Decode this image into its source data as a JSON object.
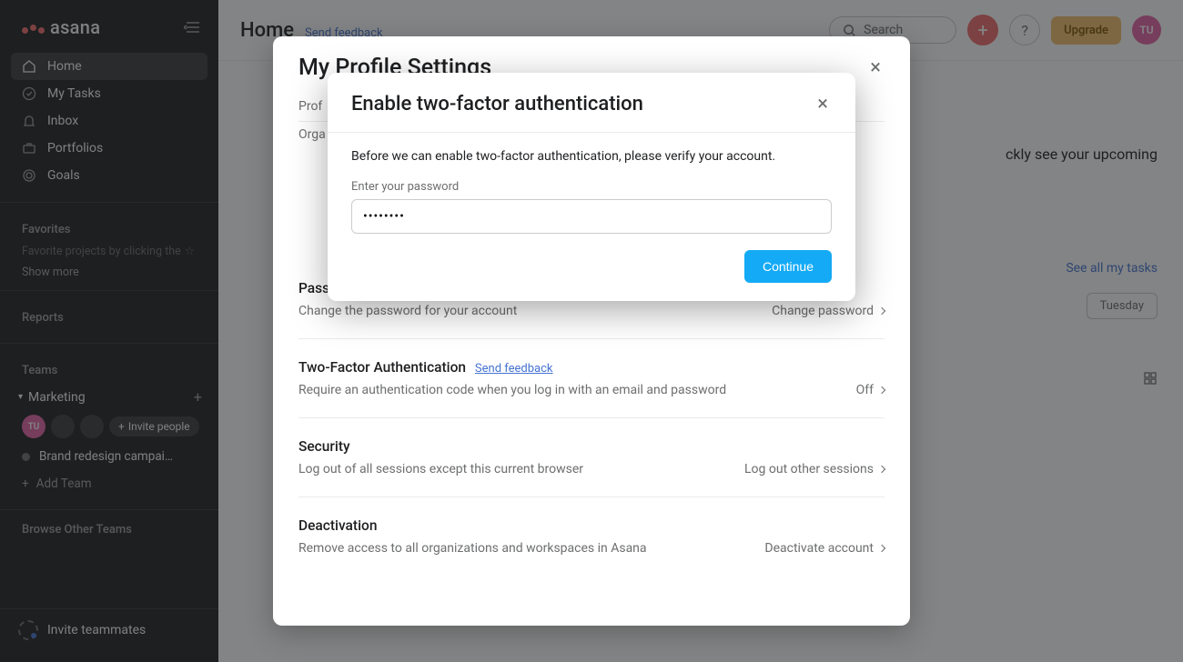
{
  "sidebar": {
    "logo_text": "asana",
    "nav": [
      {
        "label": "Home",
        "icon": "house-icon",
        "active": true
      },
      {
        "label": "My Tasks",
        "icon": "check-circle-icon",
        "active": false
      },
      {
        "label": "Inbox",
        "icon": "bell-icon",
        "active": false
      },
      {
        "label": "Portfolios",
        "icon": "portfolio-icon",
        "active": false
      },
      {
        "label": "Goals",
        "icon": "target-icon",
        "active": false
      }
    ],
    "favorites_label": "Favorites",
    "favorites_hint": "Favorite projects by clicking the",
    "show_more": "Show more",
    "reports_label": "Reports",
    "teams_label": "Teams",
    "team_name": "Marketing",
    "invite_label": "Invite people",
    "avatar_initials": "TU",
    "project_name": "Brand redesign campai…",
    "add_team": "Add Team",
    "browse_teams": "Browse Other Teams",
    "invite_teammates": "Invite teammates"
  },
  "header": {
    "title": "Home",
    "feedback": "Send feedback",
    "search_placeholder": "Search",
    "upgrade": "Upgrade",
    "user_initials": "TU"
  },
  "main": {
    "upcoming_fragment": "ckly see your upcoming",
    "see_all": "See all my tasks",
    "day": "Tuesday"
  },
  "settings": {
    "title": "My Profile Settings",
    "tab_profile_prefix": "Prof",
    "sub_prefix": "Orga",
    "password": {
      "heading_short": "Pass",
      "desc": "Change the password for your account",
      "action": "Change password"
    },
    "tfa": {
      "heading": "Two-Factor Authentication",
      "feedback": "Send feedback",
      "desc": "Require an authentication code when you log in with an email and password",
      "status": "Off"
    },
    "security": {
      "heading": "Security",
      "desc": "Log out of all sessions except this current browser",
      "action": "Log out other sessions"
    },
    "deactivation": {
      "heading": "Deactivation",
      "desc": "Remove access to all organizations and workspaces in Asana",
      "action": "Deactivate account"
    }
  },
  "tfa_modal": {
    "title": "Enable two-factor authentication",
    "intro": "Before we can enable two-factor authentication, please verify your account.",
    "field_label": "Enter your password",
    "password_value": "••••••••",
    "continue": "Continue"
  }
}
